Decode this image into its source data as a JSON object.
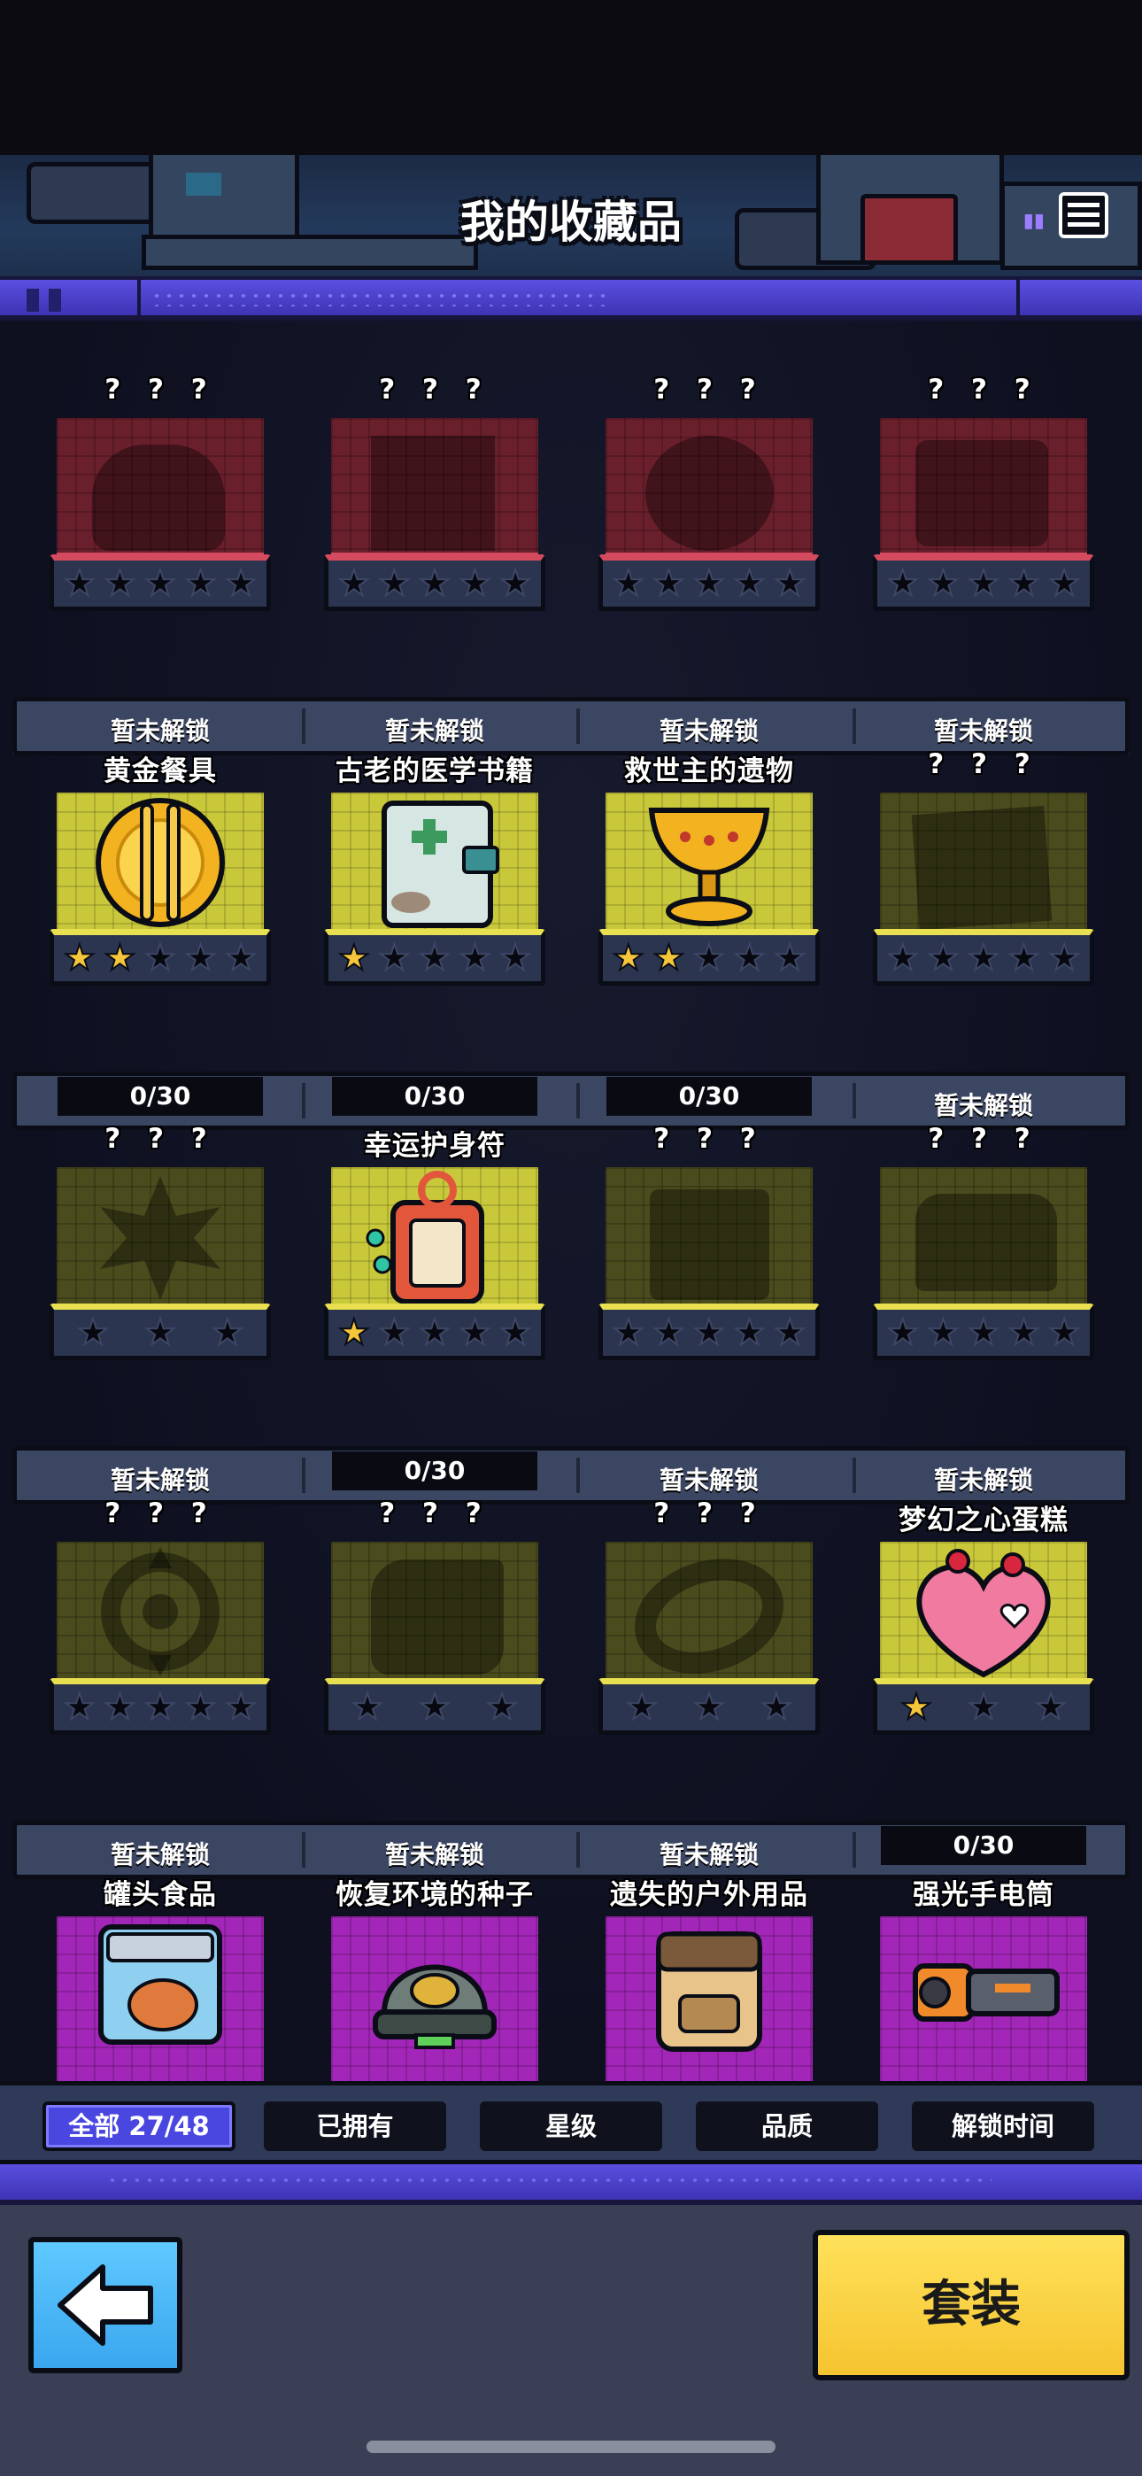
{
  "header": {
    "title": "我的收藏品",
    "menu_icon": "list-icon"
  },
  "locked_name": "? ? ?",
  "locked_label": "暂未解锁",
  "rows": [
    {
      "items": [
        {
          "name": "? ? ?",
          "frame": "red",
          "stars_total": 5,
          "stars_on": 0,
          "status": "locked",
          "status_text": "暂未解锁"
        },
        {
          "name": "? ? ?",
          "frame": "red",
          "stars_total": 5,
          "stars_on": 0,
          "status": "locked",
          "status_text": "暂未解锁"
        },
        {
          "name": "? ? ?",
          "frame": "red",
          "stars_total": 5,
          "stars_on": 0,
          "status": "locked",
          "status_text": "暂未解锁"
        },
        {
          "name": "? ? ?",
          "frame": "red",
          "stars_total": 5,
          "stars_on": 0,
          "status": "locked",
          "status_text": "暂未解锁"
        }
      ]
    },
    {
      "items": [
        {
          "name": "黄金餐具",
          "frame": "yellow",
          "stars_total": 5,
          "stars_on": 2,
          "status": "progress",
          "status_text": "0/30",
          "icon": "golden-cutlery-icon"
        },
        {
          "name": "古老的医学书籍",
          "frame": "yellow",
          "stars_total": 5,
          "stars_on": 1,
          "status": "progress",
          "status_text": "0/30",
          "icon": "medical-book-icon"
        },
        {
          "name": "救世主的遗物",
          "frame": "yellow",
          "stars_total": 5,
          "stars_on": 2,
          "status": "progress",
          "status_text": "0/30",
          "icon": "golden-chalice-icon"
        },
        {
          "name": "? ? ?",
          "frame": "dim",
          "stars_total": 5,
          "stars_on": 0,
          "status": "locked",
          "status_text": "暂未解锁"
        }
      ]
    },
    {
      "items": [
        {
          "name": "? ? ?",
          "frame": "dim",
          "stars_total": 3,
          "stars_on": 0,
          "status": "locked",
          "status_text": "暂未解锁"
        },
        {
          "name": "幸运护身符",
          "frame": "yellow",
          "stars_total": 5,
          "stars_on": 1,
          "status": "progress",
          "status_text": "0/30",
          "icon": "lucky-charm-icon"
        },
        {
          "name": "? ? ?",
          "frame": "dim",
          "stars_total": 5,
          "stars_on": 0,
          "status": "locked",
          "status_text": "暂未解锁"
        },
        {
          "name": "? ? ?",
          "frame": "dim",
          "stars_total": 5,
          "stars_on": 0,
          "status": "locked",
          "status_text": "暂未解锁"
        }
      ]
    },
    {
      "items": [
        {
          "name": "? ? ?",
          "frame": "dim",
          "stars_total": 5,
          "stars_on": 0,
          "status": "locked",
          "status_text": "暂未解锁"
        },
        {
          "name": "? ? ?",
          "frame": "dim",
          "stars_total": 3,
          "stars_on": 0,
          "status": "locked",
          "status_text": "暂未解锁"
        },
        {
          "name": "? ? ?",
          "frame": "dim",
          "stars_total": 3,
          "stars_on": 0,
          "status": "locked",
          "status_text": "暂未解锁"
        },
        {
          "name": "梦幻之心蛋糕",
          "frame": "yellow",
          "stars_total": 3,
          "stars_on": 1,
          "status": "progress",
          "status_text": "0/30",
          "icon": "heart-cake-icon"
        }
      ]
    },
    {
      "items": [
        {
          "name": "罐头食品",
          "frame": "purple",
          "icon": "canned-food-icon"
        },
        {
          "name": "恢复环境的种子",
          "frame": "purple",
          "icon": "seed-capsule-icon"
        },
        {
          "name": "遗失的户外用品",
          "frame": "purple",
          "icon": "backpack-icon"
        },
        {
          "name": "强光手电筒",
          "frame": "purple",
          "icon": "flashlight-icon"
        }
      ]
    }
  ],
  "filters": [
    {
      "label": "全部 27/48",
      "active": true
    },
    {
      "label": "已拥有",
      "active": false
    },
    {
      "label": "星级",
      "active": false
    },
    {
      "label": "品质",
      "active": false
    },
    {
      "label": "解锁时间",
      "active": false
    }
  ],
  "footer": {
    "back_icon": "arrow-left-icon",
    "suit_label": "套装"
  },
  "colors": {
    "star_on": "#f6c63a",
    "accent_purple": "#4a47e0",
    "suit_yellow": "#f5c430",
    "back_blue": "#3aa6ee"
  }
}
